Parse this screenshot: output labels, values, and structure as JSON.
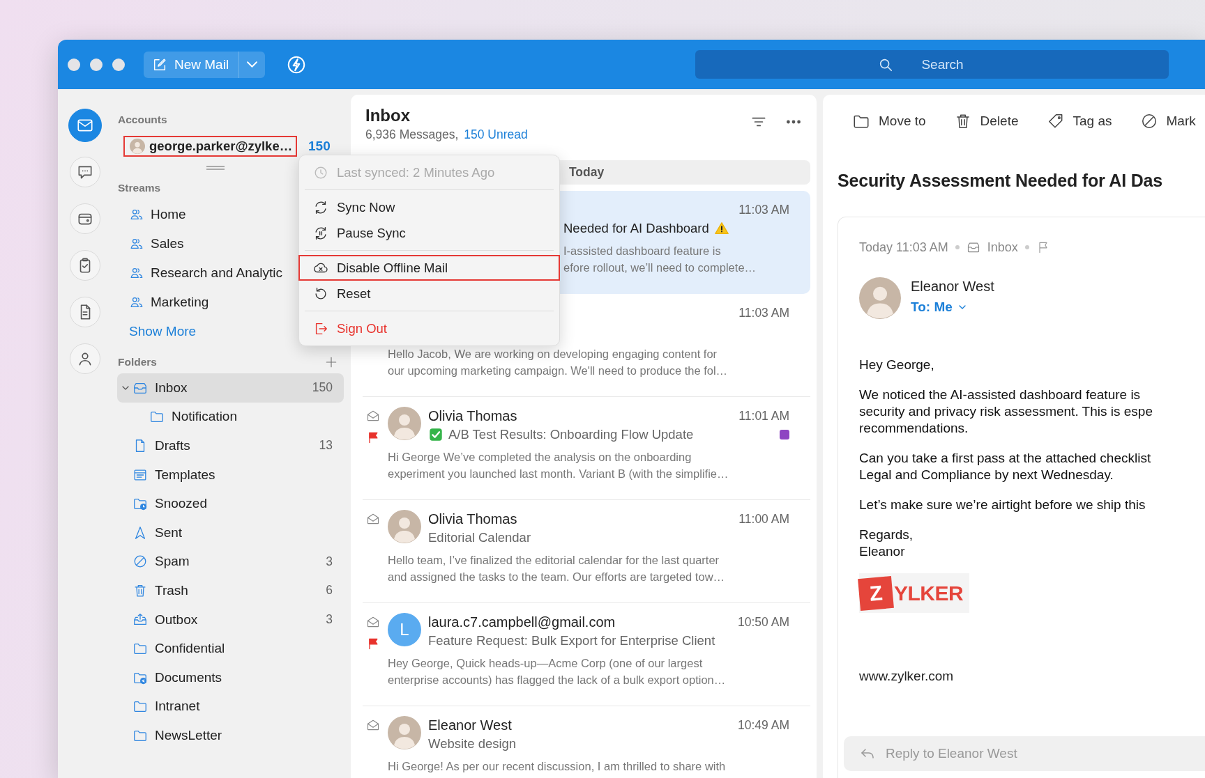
{
  "titlebar": {
    "new_mail": "New Mail",
    "search": {
      "placeholder": "Search"
    }
  },
  "rail": [
    {
      "kind": "mail",
      "selected": true
    },
    {
      "kind": "chat",
      "selected": false
    },
    {
      "kind": "wallet",
      "selected": false
    },
    {
      "kind": "tasks",
      "selected": false
    },
    {
      "kind": "notes",
      "selected": false
    },
    {
      "kind": "contacts",
      "selected": false
    }
  ],
  "sidebar": {
    "accounts_label": "Accounts",
    "account": {
      "email": "george.parker@zylke…",
      "count": "150",
      "highlighted": true
    },
    "streams_label": "Streams",
    "streams": [
      {
        "name": "Home"
      },
      {
        "name": "Sales"
      },
      {
        "name": "Research and Analytic"
      },
      {
        "name": "Marketing"
      }
    ],
    "show_more": "Show More",
    "folders_label": "Folders",
    "folders": [
      {
        "kind": "inbox",
        "name": "Inbox",
        "count": "150",
        "selected": true,
        "expanded": true,
        "children": [
          {
            "kind": "folder",
            "name": "Notification",
            "selected": false
          }
        ]
      },
      {
        "kind": "drafts",
        "name": "Drafts",
        "count": "13",
        "selected": false
      },
      {
        "kind": "templates",
        "name": "Templates",
        "selected": false
      },
      {
        "kind": "snoozed",
        "name": "Snoozed",
        "selected": false
      },
      {
        "kind": "sent",
        "name": "Sent",
        "selected": false
      },
      {
        "kind": "spam",
        "name": "Spam",
        "count": "3",
        "selected": false
      },
      {
        "kind": "trash",
        "name": "Trash",
        "count": "6",
        "selected": false
      },
      {
        "kind": "outbox",
        "name": "Outbox",
        "count": "3",
        "selected": false
      },
      {
        "kind": "folder",
        "name": "Confidential",
        "selected": false
      },
      {
        "kind": "shared",
        "name": "Documents",
        "selected": false
      },
      {
        "kind": "folder",
        "name": "Intranet",
        "selected": false
      },
      {
        "kind": "folder",
        "name": "NewsLetter",
        "selected": false
      }
    ]
  },
  "message_list": {
    "title": "Inbox",
    "count": "6,936 Messages,",
    "unread": "150 Unread",
    "group": "Today",
    "messages": [
      {
        "kind": "covered_left",
        "selected": true,
        "time": "11:03 AM",
        "subject": "Needed for AI Dashboard",
        "warning_mark": true,
        "check_mark": false,
        "preview": [
          "I-assisted dashboard feature is",
          "efore rollout, we’ll need to complete…"
        ]
      },
      {
        "kind": "covered_top",
        "selected": false,
        "time": "11:03 AM",
        "preview": [
          "Hello Jacob, We are working on developing engaging content for",
          "our upcoming marketing campaign. We'll need to produce the fol…"
        ]
      },
      {
        "kind": "full",
        "selected": false,
        "flagged": true,
        "sender": "Olivia Thomas",
        "time": "11:01 AM",
        "warning_mark": false,
        "check_mark": true,
        "subject": "A/B Test Results: Onboarding Flow Update",
        "color": "#8e44c2",
        "preview": [
          "Hi George We’ve completed the analysis on the onboarding",
          "experiment you launched last month. Variant B (with the simplifie…"
        ]
      },
      {
        "kind": "full",
        "selected": false,
        "flagged": false,
        "sender": "Olivia Thomas",
        "time": "11:00 AM",
        "subject": "Editorial Calendar",
        "preview": [
          "Hello team, I’ve finalized the editorial calendar for the last quarter",
          "and assigned the tasks to the team. Our efforts are targeted tow…"
        ]
      },
      {
        "kind": "full",
        "selected": false,
        "flagged": true,
        "sender": "laura.c7.campbell@gmail.com",
        "avatar_letter": "L",
        "time": "10:50 AM",
        "subject": "Feature Request: Bulk Export for Enterprise Client",
        "preview": [
          "Hey George, Quick heads-up—Acme Corp (one of our largest",
          "enterprise accounts) has flagged the lack of a bulk export option…"
        ]
      },
      {
        "kind": "full",
        "selected": false,
        "flagged": false,
        "sender": "Eleanor West",
        "time": "10:49 AM",
        "subject": "Website design",
        "preview": [
          "Hi George! As per our recent discussion, I am thrilled to share with"
        ]
      }
    ]
  },
  "reader": {
    "toolbar": [
      {
        "kind": "move",
        "label": "Move to"
      },
      {
        "kind": "delete",
        "label": "Delete"
      },
      {
        "kind": "tag",
        "label": "Tag as"
      },
      {
        "kind": "mark",
        "label": "Mark"
      }
    ],
    "title": "Security Assessment Needed for AI Das",
    "date": "Today 11:03 AM",
    "folder": "Inbox",
    "flagged": false,
    "sender": "Eleanor West",
    "to": "To: Me",
    "body": [
      [
        "Hey George,"
      ],
      [
        "We noticed the AI-assisted dashboard feature is",
        "security and privacy risk assessment. This is espe",
        "recommendations."
      ],
      [
        "Can you take a first pass at the attached checklist",
        "Legal and Compliance by next Wednesday."
      ],
      [
        "Let’s make sure we’re airtight before we ship this"
      ],
      [
        "Regards,",
        "Eleanor"
      ]
    ],
    "logo": {
      "mark": "Z",
      "word": "YLKER"
    },
    "website": "www.zylker.com",
    "reply": {
      "placeholder": "Reply to Eleanor West"
    }
  },
  "account_menu": {
    "groups": [
      [
        {
          "kind": "status",
          "label": "Last synced: 2 Minutes Ago",
          "disabled": true,
          "highlighted": false
        }
      ],
      [
        {
          "kind": "sync",
          "label": "Sync Now",
          "disabled": false,
          "highlighted": false
        },
        {
          "kind": "pause",
          "label": "Pause Sync",
          "disabled": false,
          "highlighted": false
        }
      ],
      [
        {
          "kind": "offline",
          "label": "Disable Offline Mail",
          "disabled": false,
          "highlighted": true
        },
        {
          "kind": "reset",
          "label": "Reset",
          "disabled": false,
          "highlighted": false
        }
      ],
      [
        {
          "kind": "signout",
          "label": "Sign Out",
          "disabled": false,
          "highlighted": false
        }
      ]
    ]
  }
}
